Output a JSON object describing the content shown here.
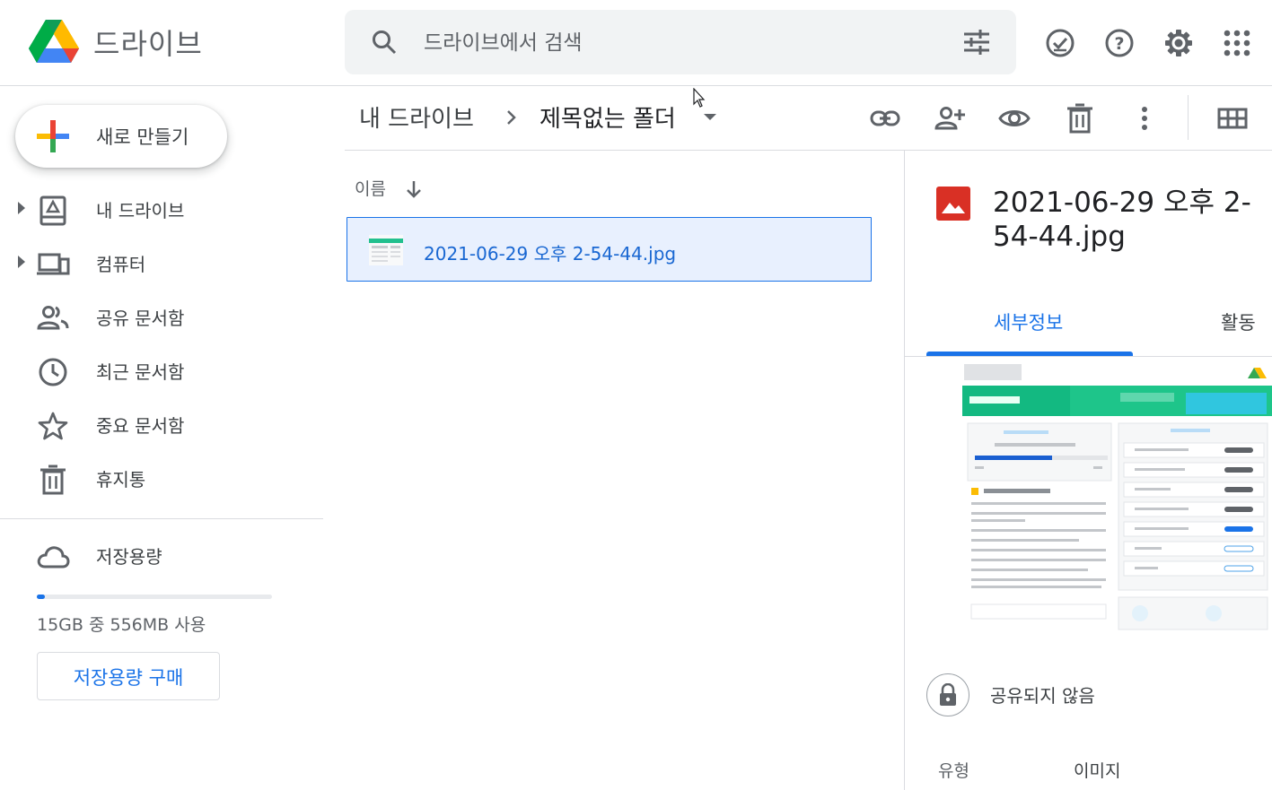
{
  "app": {
    "title": "드라이브"
  },
  "search": {
    "placeholder": "드라이브에서 검색"
  },
  "header_icons": [
    "offline-ready-icon",
    "help-icon",
    "settings-icon",
    "apps-grid-icon"
  ],
  "sidebar": {
    "new_label": "새로 만들기",
    "items": [
      {
        "label": "내 드라이브",
        "icon": "my-drive-icon",
        "expandable": true
      },
      {
        "label": "컴퓨터",
        "icon": "computers-icon",
        "expandable": true
      },
      {
        "label": "공유 문서함",
        "icon": "shared-icon",
        "expandable": false
      },
      {
        "label": "최근 문서함",
        "icon": "recent-clock-icon",
        "expandable": false
      },
      {
        "label": "중요 문서함",
        "icon": "star-icon",
        "expandable": false
      },
      {
        "label": "휴지통",
        "icon": "trash-icon",
        "expandable": false
      }
    ],
    "storage": {
      "label": "저장용량",
      "used_text": "15GB 중 556MB 사용",
      "used_fraction": 0.036,
      "buy_label": "저장용량 구매"
    }
  },
  "breadcrumb": {
    "root": "내 드라이브",
    "current": "제목없는 폴더"
  },
  "toolbar_icons": [
    "link-icon",
    "share-person-icon",
    "preview-eye-icon",
    "delete-icon",
    "more-vert-icon",
    "grid-view-icon"
  ],
  "list": {
    "sort_column": "이름",
    "files": [
      {
        "name": "2021-06-29 오후 2-54-44.jpg"
      }
    ]
  },
  "details": {
    "title": "2021-06-29 오후 2-54-44.jpg",
    "tabs": {
      "details": "세부정보",
      "activity": "활동"
    },
    "share_status": "공유되지 않음",
    "type_label": "유형",
    "type_value": "이미지"
  },
  "colors": {
    "accent": "#1a73e8",
    "selected_bg": "#e8f0fe"
  }
}
